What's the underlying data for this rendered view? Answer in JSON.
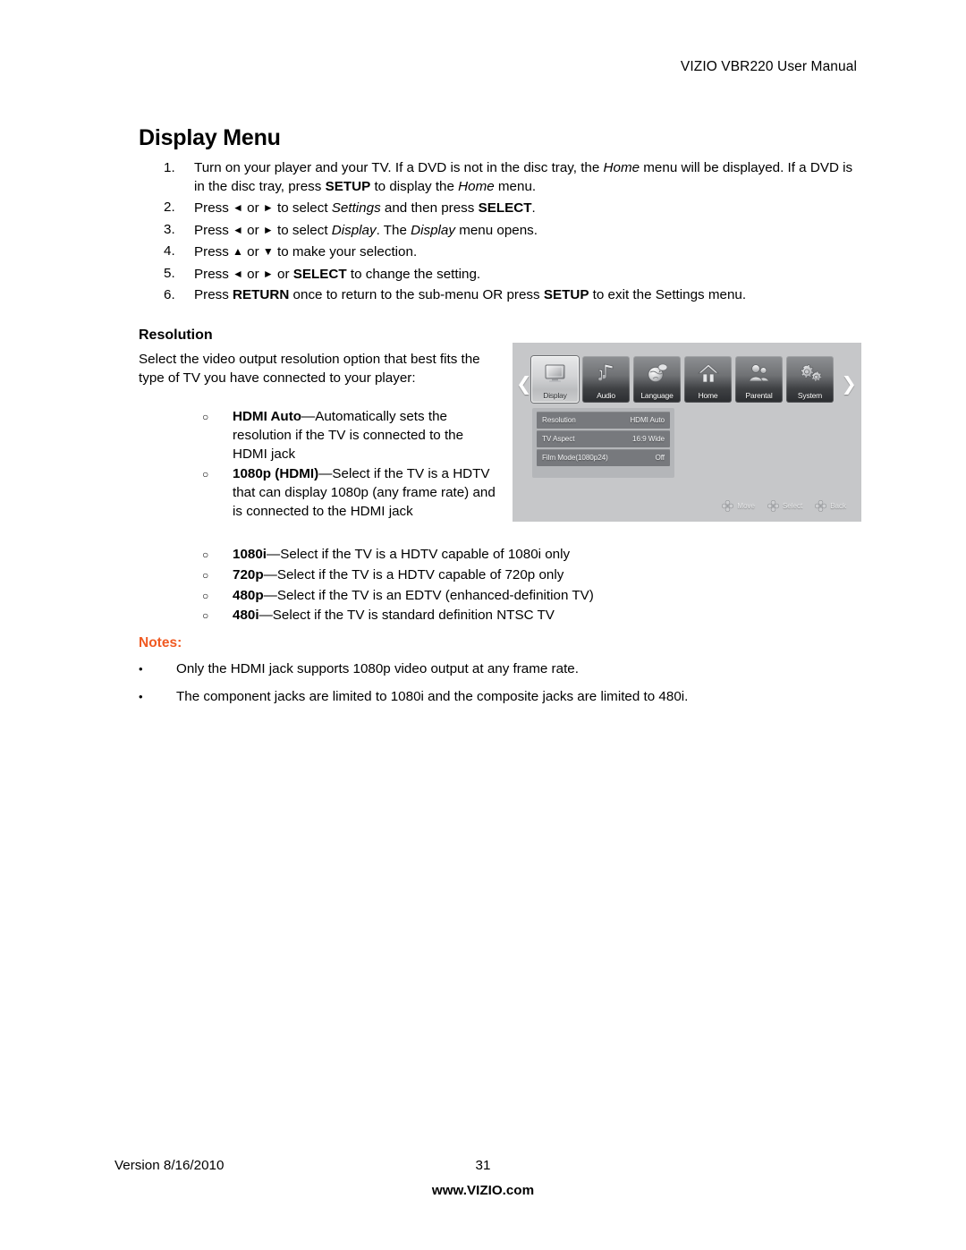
{
  "header": {
    "title": "VIZIO VBR220 User Manual"
  },
  "page_title": "Display Menu",
  "steps": [
    {
      "num": "1.",
      "segments": [
        {
          "t": "Turn on your player and your TV. If a DVD is not in the disc tray, the ",
          "s": "n"
        },
        {
          "t": "Home",
          "s": "i"
        },
        {
          "t": " menu will be displayed. If a DVD is in the disc tray, press ",
          "s": "n"
        },
        {
          "t": "SETUP",
          "s": "b"
        },
        {
          "t": " to display the ",
          "s": "n"
        },
        {
          "t": "Home",
          "s": "i"
        },
        {
          "t": " menu.",
          "s": "n"
        }
      ]
    },
    {
      "num": "2.",
      "segments": [
        {
          "t": "Press ",
          "s": "n"
        },
        {
          "t": "◄",
          "s": "a"
        },
        {
          "t": " or ",
          "s": "n"
        },
        {
          "t": "►",
          "s": "a"
        },
        {
          "t": " to select ",
          "s": "n"
        },
        {
          "t": "Settings",
          "s": "i"
        },
        {
          "t": " and then press ",
          "s": "n"
        },
        {
          "t": "SELECT",
          "s": "b"
        },
        {
          "t": ".",
          "s": "n"
        }
      ]
    },
    {
      "num": "3.",
      "segments": [
        {
          "t": "Press ",
          "s": "n"
        },
        {
          "t": "◄",
          "s": "a"
        },
        {
          "t": " or ",
          "s": "n"
        },
        {
          "t": "►",
          "s": "a"
        },
        {
          "t": " to select ",
          "s": "n"
        },
        {
          "t": "Display",
          "s": "i"
        },
        {
          "t": ". The ",
          "s": "n"
        },
        {
          "t": "Display",
          "s": "i"
        },
        {
          "t": " menu opens.",
          "s": "n"
        }
      ]
    },
    {
      "num": "4.",
      "segments": [
        {
          "t": "Press ",
          "s": "n"
        },
        {
          "t": "▲",
          "s": "a"
        },
        {
          "t": " or ",
          "s": "n"
        },
        {
          "t": "▼",
          "s": "a"
        },
        {
          "t": " to make your selection.",
          "s": "n"
        }
      ]
    },
    {
      "num": "5.",
      "segments": [
        {
          "t": "Press ",
          "s": "n"
        },
        {
          "t": "◄",
          "s": "a"
        },
        {
          "t": " or ",
          "s": "n"
        },
        {
          "t": "►",
          "s": "a"
        },
        {
          "t": " or ",
          "s": "n"
        },
        {
          "t": "SELECT",
          "s": "b"
        },
        {
          "t": " to change the setting.",
          "s": "n"
        }
      ]
    },
    {
      "num": "6.",
      "segments": [
        {
          "t": "Press ",
          "s": "n"
        },
        {
          "t": "RETURN",
          "s": "b"
        },
        {
          "t": " once to return to the sub-menu OR press ",
          "s": "n"
        },
        {
          "t": "SETUP",
          "s": "b"
        },
        {
          "t": " to exit the Settings menu.",
          "s": "n"
        }
      ]
    }
  ],
  "resolution": {
    "heading": "Resolution",
    "intro": "Select the video output resolution option that best fits the type of TV you have connected to your player:",
    "bullet_glyph": "○",
    "options_narrow": [
      {
        "term": "HDMI Auto",
        "dash": "—",
        "desc": "Automatically sets the resolution if the TV is connected to the HDMI jack"
      },
      {
        "term": "1080p (HDMI)",
        "dash": "—",
        "desc": "Select if the TV is a HDTV that can display 1080p (any frame rate) and is connected to the HDMI jack"
      }
    ],
    "options_wide": [
      {
        "term": "1080i",
        "dash": "—",
        "desc": "Select if the TV is a HDTV capable of 1080i only"
      },
      {
        "term": "720p",
        "dash": "—",
        "desc": "Select if the TV is a HDTV capable of 720p only"
      },
      {
        "term": "480p",
        "dash": "—",
        "desc": "Select if the TV is an EDTV (enhanced-definition TV)"
      },
      {
        "term": "480i",
        "dash": "—",
        "desc": "Select if the TV is standard definition NTSC TV"
      }
    ]
  },
  "notes": {
    "label": "Notes:",
    "label_color": "#F05A22",
    "bullet_glyph": "•",
    "items": [
      "Only the HDMI jack supports 1080p video output at any frame rate.",
      "The component jacks are limited to 1080i and the composite jacks are limited to 480i."
    ]
  },
  "osd": {
    "left_chevron": "❮",
    "right_chevron": "❯",
    "tabs": [
      {
        "label": "Display",
        "icon": "monitor-icon",
        "active": true
      },
      {
        "label": "Audio",
        "icon": "music-note-icon",
        "active": false
      },
      {
        "label": "Language",
        "icon": "globe-icon",
        "active": false
      },
      {
        "label": "Home",
        "icon": "house-icon",
        "active": false
      },
      {
        "label": "Parental",
        "icon": "people-icon",
        "active": false
      },
      {
        "label": "System",
        "icon": "gears-icon",
        "active": false
      }
    ],
    "rows": [
      {
        "label": "Resolution",
        "value": "HDMI Auto"
      },
      {
        "label": "TV Aspect",
        "value": "16:9 Wide"
      },
      {
        "label": "Film Mode(1080p24)",
        "value": "Off"
      }
    ],
    "hints": [
      {
        "label": "Move",
        "icon": "dpad-icon"
      },
      {
        "label": "Select",
        "icon": "dpad-icon"
      },
      {
        "label": "Back",
        "icon": "dpad-icon"
      }
    ]
  },
  "footer": {
    "version": "Version 8/16/2010",
    "page_number": "31",
    "website": "www.VIZIO.com"
  }
}
